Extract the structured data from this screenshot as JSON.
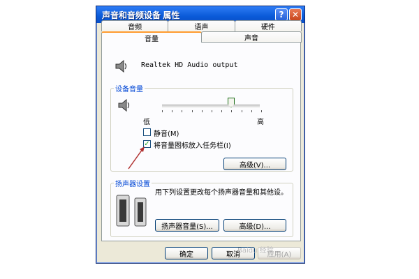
{
  "window": {
    "title": "声音和音频设备 属性",
    "help_symbol": "?",
    "close_symbol": "✕"
  },
  "tabs": {
    "back_row": [
      "音频",
      "语声",
      "硬件"
    ],
    "front_row": [
      "音量",
      "声音"
    ],
    "active": "音量"
  },
  "device": {
    "name": "Realtek HD Audio output",
    "icon": "speaker-icon"
  },
  "device_volume": {
    "group_label": "设备音量",
    "low_label": "低",
    "high_label": "高",
    "level_fraction": 0.7,
    "mute": {
      "label": "静音(M)",
      "checked": false
    },
    "taskbar": {
      "label": "将音量图标放入任务栏(I)",
      "checked": true
    },
    "advanced_button": "高级(V)..."
  },
  "speaker_settings": {
    "group_label": "扬声器设置",
    "description": "用下列设置更改每个扬声器音量和其他设。",
    "volume_button": "扬声器音量(S)...",
    "advanced_button": "高级(D)..."
  },
  "footer": {
    "ok": "确定",
    "cancel": "取消",
    "apply": "应用(A)"
  },
  "watermark": "Baidu 经验",
  "colors": {
    "title_bar": "#0a5ad8",
    "group_label": "#0046d5",
    "active_tab_accent": "#ff9b2e",
    "arrow": "#b03030"
  }
}
